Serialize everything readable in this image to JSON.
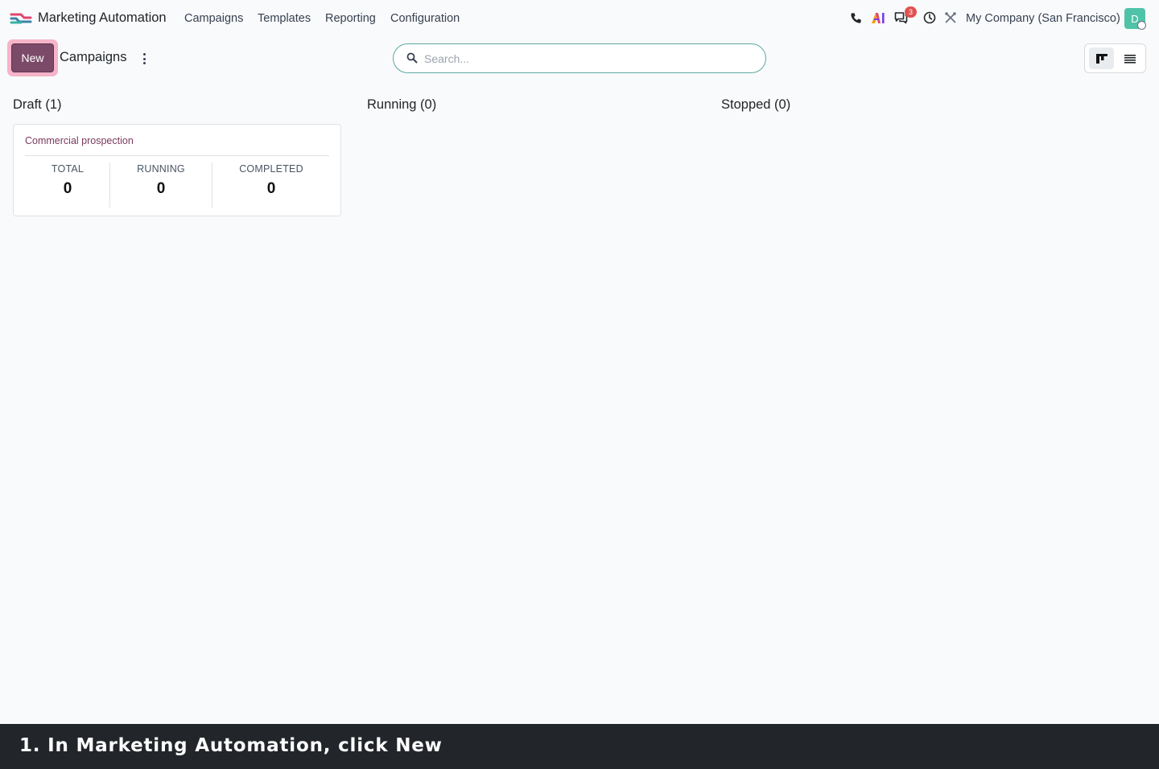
{
  "navbar": {
    "app_name": "Marketing Automation",
    "menu": [
      "Campaigns",
      "Templates",
      "Reporting",
      "Configuration"
    ],
    "messages_badge": "3",
    "company": "My Company (San Francisco)",
    "avatar_initial": "D",
    "icons": [
      "phone-icon",
      "ai-icon",
      "chat-icon",
      "clock-icon",
      "tools-icon"
    ]
  },
  "control_panel": {
    "new_label": "New",
    "breadcrumb": "Campaigns",
    "search_placeholder": "Search..."
  },
  "columns": [
    {
      "title": "Draft (1)"
    },
    {
      "title": "Running (0)"
    },
    {
      "title": "Stopped (0)"
    }
  ],
  "card": {
    "title": "Commercial prospection",
    "stats": [
      {
        "label": "TOTAL",
        "value": "0"
      },
      {
        "label": "RUNNING",
        "value": "0"
      },
      {
        "label": "COMPLETED",
        "value": "0"
      }
    ]
  },
  "instruction": "1. In Marketing Automation, click New",
  "colors": {
    "primary": "#7b4a68",
    "highlight": "#f5b4c8",
    "badge": "#e05252",
    "avatar": "#4fc3a8"
  }
}
